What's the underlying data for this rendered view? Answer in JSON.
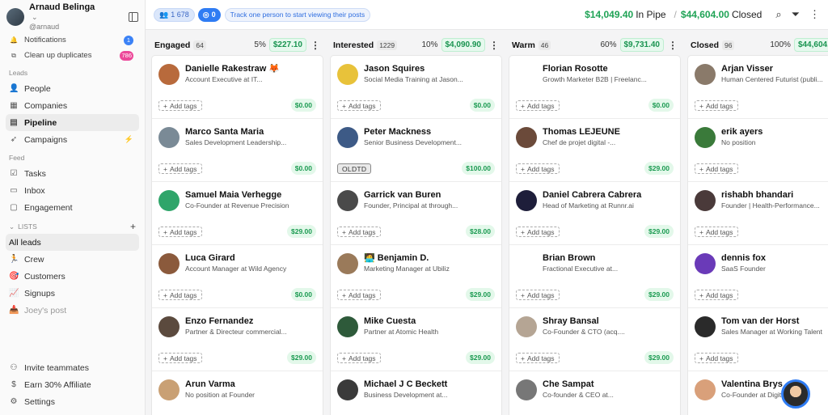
{
  "user": {
    "name": "Arnaud Belinga",
    "handle": "@arnaud"
  },
  "sidebar": {
    "top": [
      {
        "label": "Notifications",
        "icon": "bell-icon",
        "badge": "1",
        "badge_color": "#3b82f6"
      },
      {
        "label": "Clean up duplicates",
        "icon": "merge-icon",
        "badge": "786",
        "badge_color": "#ec4899"
      }
    ],
    "leads_title": "Leads",
    "leads": [
      {
        "label": "People",
        "icon": "person-icon"
      },
      {
        "label": "Companies",
        "icon": "building-icon"
      },
      {
        "label": "Pipeline",
        "icon": "pipeline-icon"
      },
      {
        "label": "Campaigns",
        "icon": "send-icon"
      }
    ],
    "feed_title": "Feed",
    "feed": [
      {
        "label": "Tasks",
        "icon": "check-square-icon"
      },
      {
        "label": "Inbox",
        "icon": "inbox-icon"
      },
      {
        "label": "Engagement",
        "icon": "chat-icon"
      }
    ],
    "lists_title": "LISTS",
    "lists": [
      {
        "label": "All leads",
        "emoji": ""
      },
      {
        "label": "Crew",
        "emoji": "🏃"
      },
      {
        "label": "Customers",
        "emoji": "🎯"
      },
      {
        "label": "Signups",
        "emoji": "📈"
      },
      {
        "label": "Joey's post",
        "emoji": "📥"
      }
    ],
    "bottom": [
      {
        "label": "Invite teammates",
        "icon": "user-plus-icon"
      },
      {
        "label": "Earn 30% Affiliate",
        "icon": "dollar-icon"
      },
      {
        "label": "Settings",
        "icon": "gear-icon"
      }
    ]
  },
  "topbar": {
    "people_count": "1 678",
    "tracked_count": "0",
    "track_text": "Track one person to start viewing their posts",
    "pipe_value": "$14,049.40",
    "pipe_label": "In Pipe",
    "closed_value": "$44,604.00",
    "closed_label": "Closed"
  },
  "columns": [
    {
      "title": "Engaged",
      "count": "64",
      "pct": "5%",
      "value": "$227.10",
      "bar": "#dcdce0",
      "cards": [
        {
          "name": "Danielle Rakestraw 🦊",
          "job": "Account Executive at IT...",
          "tag": "Add tags",
          "amount": "$0.00",
          "color": "#b86a3c"
        },
        {
          "name": "Marco Santa Maria",
          "job": "Sales Development Leadership...",
          "tag": "Add tags",
          "amount": "$0.00",
          "color": "#7a8a96"
        },
        {
          "name": "Samuel Maia Verhegge",
          "job": "Co-Founder at Revenue Precision",
          "tag": "Add tags",
          "amount": "$29.00",
          "color": "#2fa56a"
        },
        {
          "name": "Luca Girard",
          "job": "Account Manager at Wild Agency",
          "tag": "Add tags",
          "amount": "$0.00",
          "color": "#8b5a3c"
        },
        {
          "name": "Enzo Fernandez",
          "job": "Partner & Directeur commercial...",
          "tag": "Add tags",
          "amount": "$29.00",
          "color": "#5b4a3e"
        },
        {
          "name": "Arun Varma",
          "job": "No position at Founder",
          "tag": "Add tags",
          "amount": "",
          "color": "#c9a074"
        }
      ]
    },
    {
      "title": "Interested",
      "count": "1229",
      "pct": "10%",
      "value": "$4,090.90",
      "bar": "#dcdce0",
      "cards": [
        {
          "name": "Jason Squires",
          "job": "Social Media Training at Jason...",
          "tag": "Add tags",
          "amount": "$0.00",
          "color": "#e8c23a"
        },
        {
          "name": "Peter Mackness",
          "job": "Senior Business Development...",
          "tag": "OLDTD",
          "amount": "$100.00",
          "color": "#3d5a86",
          "solid": true
        },
        {
          "name": "Garrick van Buren",
          "job": "Founder, Principal at through...",
          "tag": "Add tags",
          "amount": "$28.00",
          "color": "#4a4a4a"
        },
        {
          "name": "🧑‍💻 Benjamin D.",
          "job": "Marketing Manager at Ubiliz",
          "tag": "Add tags",
          "amount": "$29.00",
          "color": "#9a7a5a"
        },
        {
          "name": "Mike Cuesta",
          "job": "Partner at Atomic Health",
          "tag": "Add tags",
          "amount": "$29.00",
          "color": "#2e5a3a"
        },
        {
          "name": "Michael J C Beckett",
          "job": "Business Development at...",
          "tag": "Add tags",
          "amount": "",
          "color": "#3a3a3a"
        }
      ]
    },
    {
      "title": "Warm",
      "count": "46",
      "pct": "60%",
      "value": "$9,731.40",
      "bar": "#dcdce0",
      "cards": [
        {
          "name": "Florian Rosotte",
          "job": "Growth Marketer B2B | Freelanc...",
          "tag": "Add tags",
          "amount": "$0.00",
          "color": "#ffffff"
        },
        {
          "name": "Thomas LEJEUNE",
          "job": "Chef de projet digital -...",
          "tag": "Add tags",
          "amount": "$29.00",
          "color": "#6b4a3a"
        },
        {
          "name": "Daniel Cabrera Cabrera",
          "job": "Head of Marketing at Runnr.ai",
          "tag": "Add tags",
          "amount": "$29.00",
          "color": "#1e1e3a"
        },
        {
          "name": "Brian Brown",
          "job": "Fractional Executive at...",
          "tag": "Add tags",
          "amount": "$29.00",
          "color": "#ffffff"
        },
        {
          "name": "Shray Bansal",
          "job": "Co-Founder & CTO (acq....",
          "tag": "Add tags",
          "amount": "$29.00",
          "color": "#b5a594"
        },
        {
          "name": "Che Sampat",
          "job": "Co-founder & CEO at...",
          "tag": "Add tags",
          "amount": "",
          "color": "#777"
        }
      ]
    },
    {
      "title": "Closed",
      "count": "96",
      "pct": "100%",
      "value": "$44,604.00",
      "bar": "#3fd48a",
      "cards": [
        {
          "name": "Arjan Visser",
          "job": "Human Centered Futurist (publi...",
          "tag": "Add tags",
          "amount": "",
          "color": "#8a7a6a"
        },
        {
          "name": "erik ayers",
          "job": "No position",
          "tag": "Add tags",
          "amount": "",
          "color": "#3a7a3a"
        },
        {
          "name": "rishabh bhandari",
          "job": "Founder | Health-Performance...",
          "tag": "Add tags",
          "amount": "",
          "color": "#4a3a3a"
        },
        {
          "name": "dennis fox",
          "job": "SaaS Founder",
          "tag": "Add tags",
          "amount": "",
          "color": "#6a3ab8"
        },
        {
          "name": "Tom van der Horst",
          "job": "Sales Manager at Working Talent",
          "tag": "Add tags",
          "amount": "",
          "color": "#2a2a2a"
        },
        {
          "name": "Valentina Brys",
          "job": "Co-Founder at Digit...",
          "tag": "Add tags",
          "amount": "",
          "color": "#d9a07a"
        }
      ]
    }
  ]
}
